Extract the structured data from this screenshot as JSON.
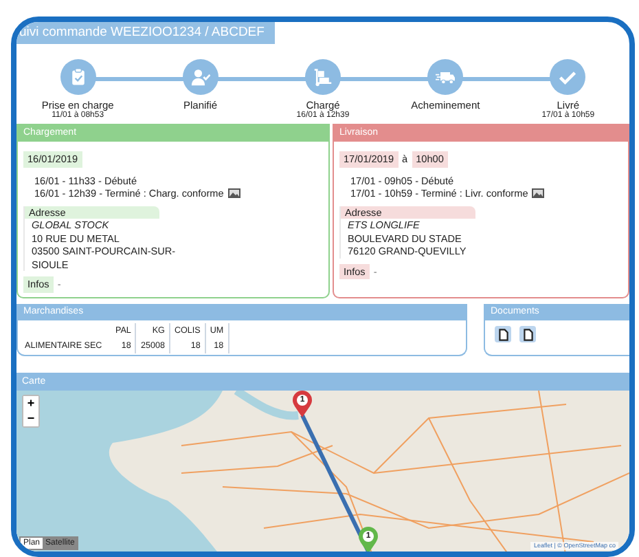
{
  "title": "uivi commande WEEZIOO1234 / ABCDEF",
  "steps": [
    {
      "kind": "clipboard",
      "label": "Prise en charge",
      "time": "11/01 à 08h53"
    },
    {
      "kind": "user",
      "label": "Planifié"
    },
    {
      "kind": "dolly",
      "label": "Chargé",
      "time": "16/01 à 12h39"
    },
    {
      "kind": "truck",
      "label": "Acheminement"
    },
    {
      "kind": "check",
      "label": "Livré",
      "time": "17/01 à 10h59"
    }
  ],
  "panels": [
    {
      "kind": "loading",
      "title": "Chargement",
      "date": "16/01/2019",
      "events": [
        {
          "text": "16/01 - 11h33 - Débuté",
          "photo": false
        },
        {
          "text": "16/01 - 12h39 - Terminé : Charg. conforme",
          "photo": true
        }
      ],
      "address_label": "Adresse",
      "address_name": "GLOBAL STOCK",
      "address_lines": [
        "10 RUE DU METAL",
        "03500 SAINT-POURCAIN-SUR-",
        "SIOULE"
      ],
      "infos_label": "Infos",
      "infos_value": "-"
    },
    {
      "kind": "delivery",
      "title": "Livraison",
      "date": "17/01/2019",
      "at": "à",
      "time": "10h00",
      "events": [
        {
          "text": "17/01 - 09h05 - Débuté",
          "photo": false
        },
        {
          "text": "17/01 - 10h59 - Terminé : Livr. conforme",
          "photo": true
        }
      ],
      "address_label": "Adresse",
      "address_name": "ETS LONGLIFE",
      "address_lines": [
        "BOULEVARD DU STADE",
        "76120 GRAND-QUEVILLY"
      ],
      "infos_label": "Infos",
      "infos_value": "-"
    }
  ],
  "goods": {
    "title": "Marchandises",
    "columns": [
      "PAL",
      "KG",
      "COLIS",
      "UM"
    ],
    "rows": [
      {
        "name": "ALIMENTAIRE SEC",
        "cells": [
          "18",
          "25008",
          "18",
          "18"
        ]
      }
    ]
  },
  "documents": {
    "title": "Documents",
    "files": [
      {
        "kind": "file"
      },
      {
        "kind": "file"
      }
    ]
  },
  "map": {
    "title": "Carte",
    "zoom_in": "+",
    "zoom_out": "−",
    "layers": [
      {
        "label": "Plan",
        "selected": true
      },
      {
        "label": "Satellite",
        "selected": false
      }
    ],
    "markers": [
      {
        "label": "1",
        "color": "#d63a3f"
      },
      {
        "label": "1",
        "color": "#62b84a"
      }
    ],
    "attribution": "Leaflet | © OpenStreetMap co"
  }
}
